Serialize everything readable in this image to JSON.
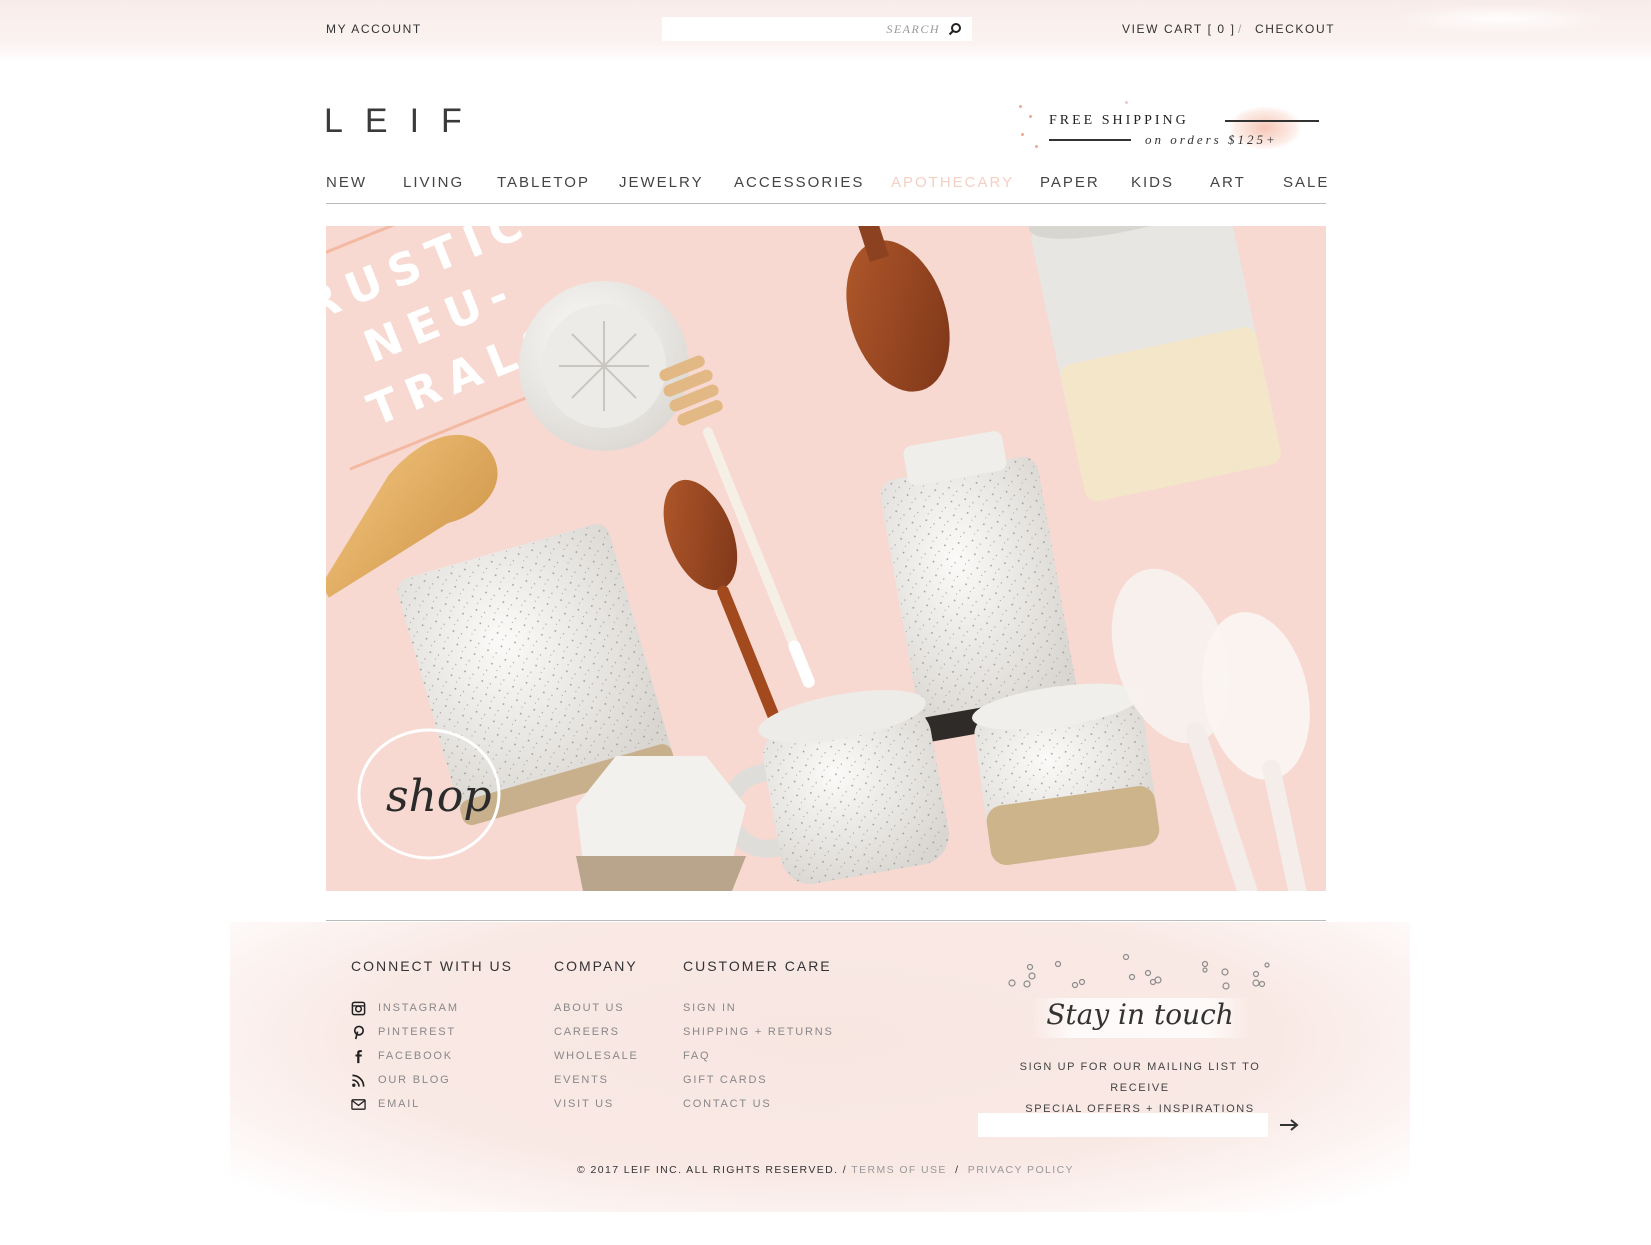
{
  "topbar": {
    "my_account": "MY ACCOUNT",
    "search_placeholder": "SEARCH",
    "view_cart": "VIEW CART [ 0 ]",
    "separator": "/",
    "checkout": "CHECKOUT"
  },
  "logo": "LEIF",
  "promo": {
    "line1": "FREE SHIPPING",
    "line2": "on orders $125+"
  },
  "nav": {
    "items": [
      "NEW",
      "LIVING",
      "TABLETOP",
      "JEWELRY",
      "ACCESSORIES",
      "APOTHECARY",
      "PAPER",
      "KIDS",
      "ART",
      "SALE"
    ],
    "active": "APOTHECARY"
  },
  "hero": {
    "headline_line1": "RUSTIC",
    "headline_line2": "NEU-",
    "headline_line3": "TRALS",
    "shop_label": "shop"
  },
  "footer": {
    "connect": {
      "title": "CONNECT WITH US",
      "items": [
        {
          "label": "INSTAGRAM",
          "icon": "instagram-icon"
        },
        {
          "label": "PINTEREST",
          "icon": "pinterest-icon"
        },
        {
          "label": "FACEBOOK",
          "icon": "facebook-icon"
        },
        {
          "label": "OUR BLOG",
          "icon": "rss-icon"
        },
        {
          "label": "EMAIL",
          "icon": "envelope-icon"
        }
      ]
    },
    "company": {
      "title": "COMPANY",
      "items": [
        "ABOUT US",
        "CAREERS",
        "WHOLESALE",
        "EVENTS",
        "VISIT US"
      ]
    },
    "customer_care": {
      "title": "CUSTOMER CARE",
      "items": [
        "SIGN IN",
        "SHIPPING + RETURNS",
        "FAQ",
        "GIFT CARDS",
        "CONTACT US"
      ]
    },
    "newsletter": {
      "title": "Stay in touch",
      "text_line1": "SIGN UP FOR OUR MAILING LIST TO RECEIVE",
      "text_line2": "SPECIAL OFFERS + INSPIRATIONS",
      "input_placeholder": ""
    },
    "copyright": "© 2017 LEIF INC. ALL RIGHTS RESERVED. /",
    "terms": "TERMS OF USE",
    "slash": "/",
    "privacy": "PRIVACY POLICY"
  },
  "colors": {
    "accent_pink": "#f6cfc4",
    "hero_bg": "#f7d9d1",
    "text": "#333333"
  }
}
